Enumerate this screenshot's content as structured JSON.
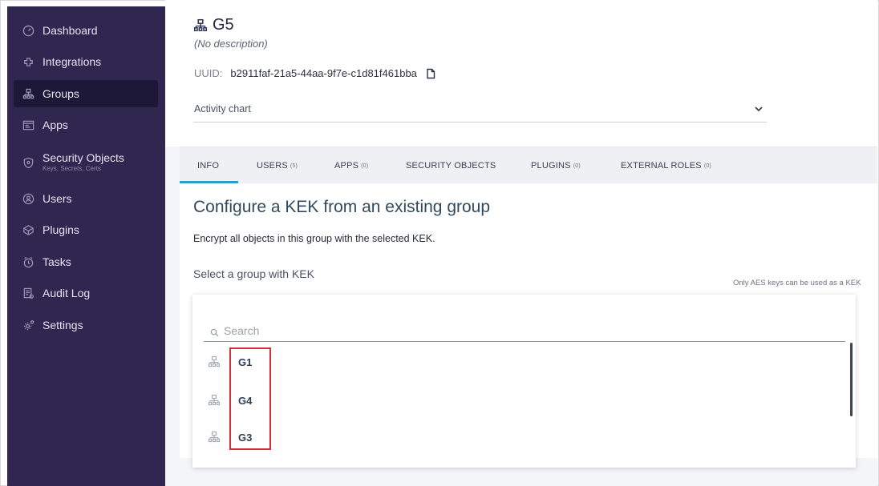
{
  "sidebar": {
    "items": [
      {
        "label": "Dashboard",
        "icon": "dashboard-icon"
      },
      {
        "label": "Integrations",
        "icon": "integrations-icon"
      },
      {
        "label": "Groups",
        "icon": "groups-icon",
        "active": true
      },
      {
        "label": "Apps",
        "icon": "apps-icon"
      },
      {
        "label": "Security Objects",
        "sublabel": "Keys, Secrets, Certs",
        "icon": "security-objects-icon"
      },
      {
        "label": "Users",
        "icon": "users-icon"
      },
      {
        "label": "Plugins",
        "icon": "plugins-icon"
      },
      {
        "label": "Tasks",
        "icon": "tasks-icon"
      },
      {
        "label": "Audit Log",
        "icon": "audit-log-icon"
      },
      {
        "label": "Settings",
        "icon": "settings-icon"
      }
    ]
  },
  "group": {
    "name": "G5",
    "description": "(No description)",
    "uuid_label": "UUID:",
    "uuid": "b2911faf-21a5-44aa-9f7e-c1d81f461bba",
    "activity_chart_label": "Activity chart"
  },
  "tabs": [
    {
      "label": "INFO",
      "count": ""
    },
    {
      "label": "USERS",
      "count": "(5)"
    },
    {
      "label": "APPS",
      "count": "(0)"
    },
    {
      "label": "SECURITY OBJECTS",
      "count": ""
    },
    {
      "label": "PLUGINS",
      "count": "(0)"
    },
    {
      "label": "EXTERNAL ROLES",
      "count": "(0)"
    }
  ],
  "content": {
    "heading": "Configure a KEK from an existing group",
    "subtitle": "Encrypt all objects in this group with the selected KEK.",
    "select_label": "Select a group with KEK",
    "hint": "Only AES keys can be used as a KEK"
  },
  "dropdown": {
    "search_placeholder": "Search",
    "options": [
      "G1",
      "G4",
      "G3"
    ]
  },
  "colors": {
    "sidebar_bg": "#2f2750",
    "tab_accent": "#2a9dc9",
    "highlight_border": "#d2303d"
  }
}
